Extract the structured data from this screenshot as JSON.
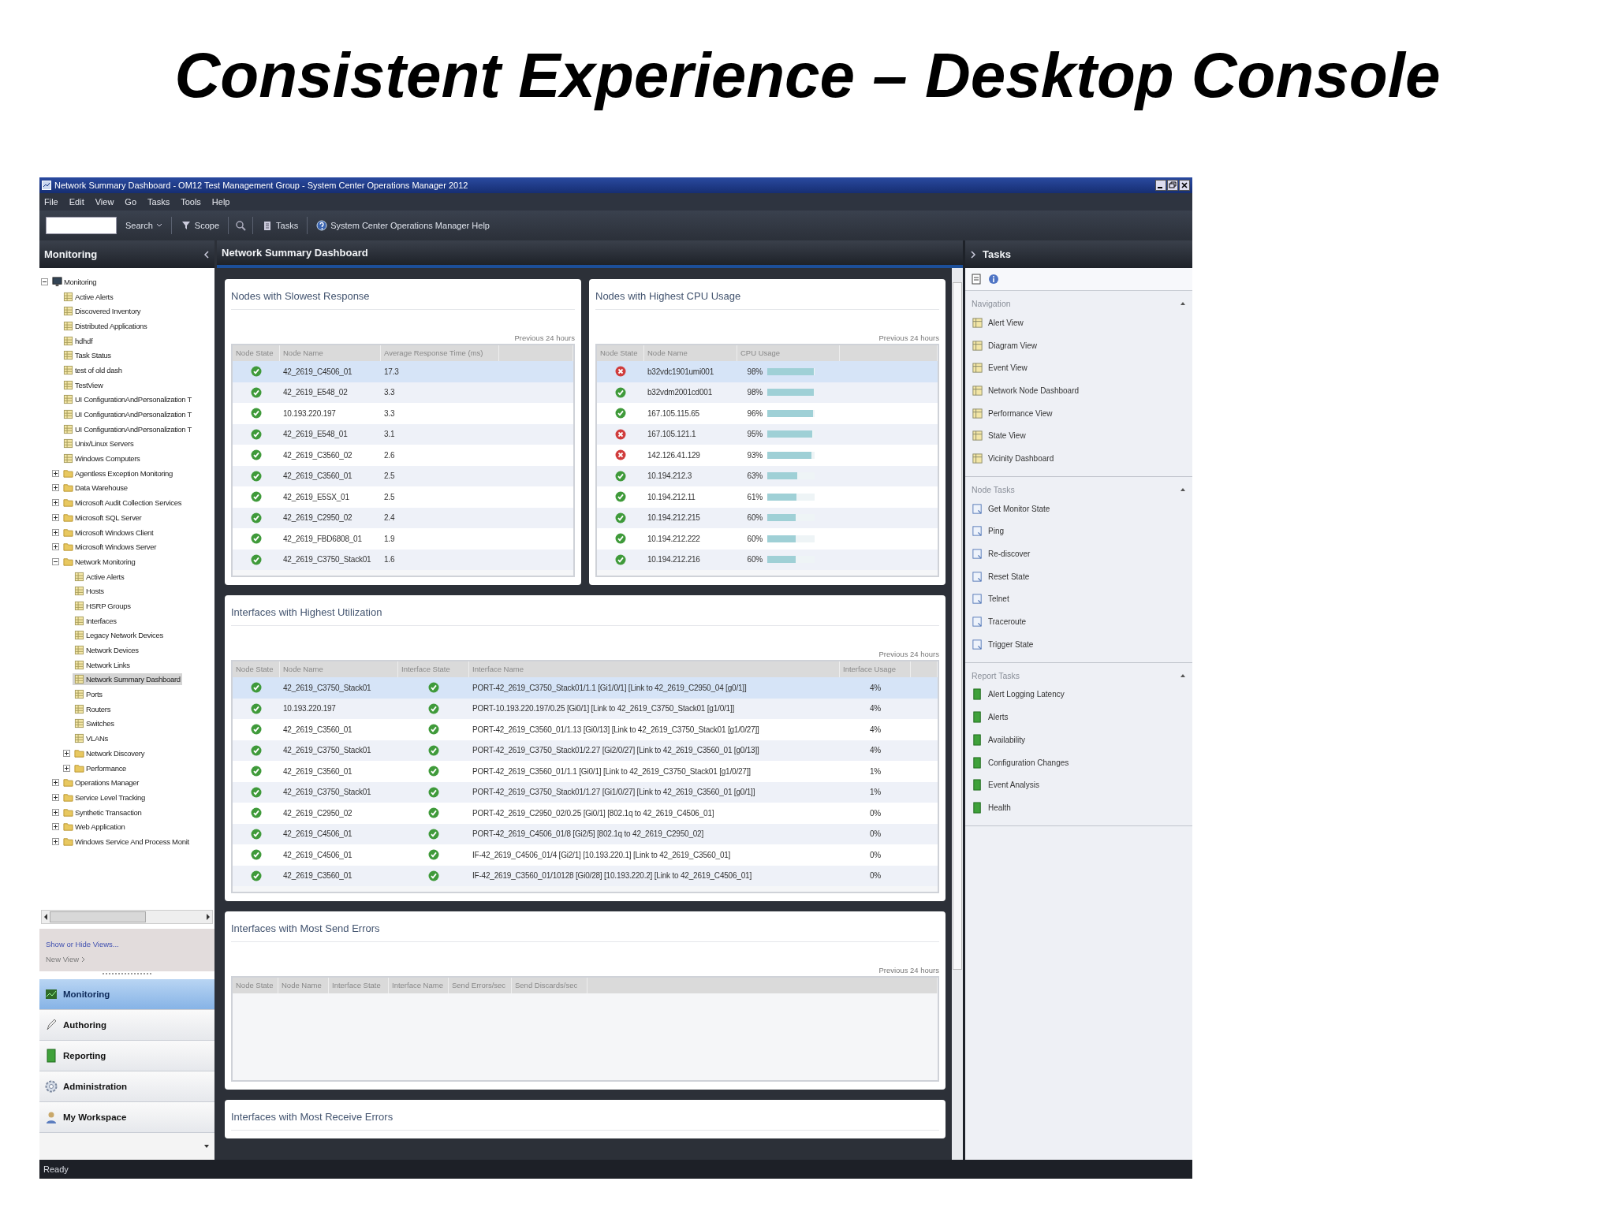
{
  "slide_title": "Consistent Experience – Desktop Console",
  "window": {
    "title": "Network Summary Dashboard - OM12 Test Management Group - System Center Operations Manager 2012"
  },
  "menu": [
    "File",
    "Edit",
    "View",
    "Go",
    "Tasks",
    "Tools",
    "Help"
  ],
  "toolbar": {
    "search_button": "Search",
    "scope_button": "Scope",
    "tasks_button": "Tasks",
    "help_button": "System Center Operations Manager Help"
  },
  "navigation_pane": {
    "header": "Monitoring",
    "tree": [
      {
        "label": "Monitoring",
        "kind": "root",
        "expanded": true,
        "selected": false,
        "children": [
          {
            "label": "Active Alerts",
            "kind": "view",
            "selected": false
          },
          {
            "label": "Discovered Inventory",
            "kind": "view",
            "selected": false
          },
          {
            "label": "Distributed Applications",
            "kind": "view",
            "selected": false
          },
          {
            "label": "hdhdf",
            "kind": "view",
            "selected": false
          },
          {
            "label": "Task Status",
            "kind": "view",
            "selected": false
          },
          {
            "label": "test of old dash",
            "kind": "view",
            "selected": false
          },
          {
            "label": "TestView",
            "kind": "view",
            "selected": false
          },
          {
            "label": "UI ConfigurationAndPersonalization T",
            "kind": "view",
            "selected": false
          },
          {
            "label": "UI ConfigurationAndPersonalization T",
            "kind": "view",
            "selected": false
          },
          {
            "label": "UI ConfigurationAndPersonalization T",
            "kind": "view",
            "selected": false
          },
          {
            "label": "Unix/Linux Servers",
            "kind": "view",
            "selected": false
          },
          {
            "label": "Windows Computers",
            "kind": "view",
            "selected": false
          },
          {
            "label": "Agentless Exception Monitoring",
            "kind": "folder",
            "expanded": false,
            "selected": false
          },
          {
            "label": "Data Warehouse",
            "kind": "folder",
            "expanded": false,
            "selected": false
          },
          {
            "label": "Microsoft Audit Collection Services",
            "kind": "folder",
            "expanded": false,
            "selected": false
          },
          {
            "label": "Microsoft SQL Server",
            "kind": "folder",
            "expanded": false,
            "selected": false
          },
          {
            "label": "Microsoft Windows Client",
            "kind": "folder",
            "expanded": false,
            "selected": false
          },
          {
            "label": "Microsoft Windows Server",
            "kind": "folder",
            "expanded": false,
            "selected": false
          },
          {
            "label": "Network Monitoring",
            "kind": "folder",
            "expanded": true,
            "selected": false,
            "children": [
              {
                "label": "Active Alerts",
                "kind": "view",
                "selected": false
              },
              {
                "label": "Hosts",
                "kind": "view",
                "selected": false
              },
              {
                "label": "HSRP Groups",
                "kind": "view",
                "selected": false
              },
              {
                "label": "Interfaces",
                "kind": "view",
                "selected": false
              },
              {
                "label": "Legacy Network Devices",
                "kind": "view",
                "selected": false
              },
              {
                "label": "Network Devices",
                "kind": "view",
                "selected": false
              },
              {
                "label": "Network Links",
                "kind": "view",
                "selected": false
              },
              {
                "label": "Network Summary Dashboard",
                "kind": "view",
                "selected": true
              },
              {
                "label": "Ports",
                "kind": "view",
                "selected": false
              },
              {
                "label": "Routers",
                "kind": "view",
                "selected": false
              },
              {
                "label": "Switches",
                "kind": "view",
                "selected": false
              },
              {
                "label": "VLANs",
                "kind": "view",
                "selected": false
              },
              {
                "label": "Network Discovery",
                "kind": "folder",
                "expanded": false,
                "selected": false
              },
              {
                "label": "Performance",
                "kind": "folder",
                "expanded": false,
                "selected": false
              }
            ]
          },
          {
            "label": "Operations Manager",
            "kind": "folder",
            "expanded": false,
            "selected": false
          },
          {
            "label": "Service Level Tracking",
            "kind": "folder",
            "expanded": false,
            "selected": false
          },
          {
            "label": "Synthetic Transaction",
            "kind": "folder",
            "expanded": false,
            "selected": false
          },
          {
            "label": "Web Application",
            "kind": "folder",
            "expanded": false,
            "selected": false
          },
          {
            "label": "Windows Service And Process Monit",
            "kind": "folder",
            "expanded": false,
            "selected": false
          }
        ]
      }
    ],
    "show_hide_link": "Show or Hide Views...",
    "new_view": {
      "label": "New View",
      "disabled": true
    },
    "workspaces": [
      {
        "label": "Monitoring",
        "selected": true
      },
      {
        "label": "Authoring",
        "selected": false
      },
      {
        "label": "Reporting",
        "selected": false
      },
      {
        "label": "Administration",
        "selected": false
      },
      {
        "label": "My Workspace",
        "selected": false
      }
    ]
  },
  "dashboard": {
    "header": "Network Summary Dashboard",
    "widgets": [
      {
        "kind": "response",
        "title": "Nodes with Slowest Response",
        "period": "Previous 24 hours",
        "columns": [
          "Node State",
          "Node Name",
          "Average Response Time (ms)"
        ],
        "rows": [
          {
            "selected": true,
            "node_healthy": true,
            "node_name": "42_2619_C4506_01",
            "response_time": "17.3"
          },
          {
            "selected": false,
            "node_healthy": true,
            "node_name": "42_2619_E548_02",
            "response_time": "3.3"
          },
          {
            "selected": false,
            "node_healthy": true,
            "node_name": "10.193.220.197",
            "response_time": "3.3"
          },
          {
            "selected": false,
            "node_healthy": true,
            "node_name": "42_2619_E548_01",
            "response_time": "3.1"
          },
          {
            "selected": false,
            "node_healthy": true,
            "node_name": "42_2619_C3560_02",
            "response_time": "2.6"
          },
          {
            "selected": false,
            "node_healthy": true,
            "node_name": "42_2619_C3560_01",
            "response_time": "2.5"
          },
          {
            "selected": false,
            "node_healthy": true,
            "node_name": "42_2619_E5SX_01",
            "response_time": "2.5"
          },
          {
            "selected": false,
            "node_healthy": true,
            "node_name": "42_2619_C2950_02",
            "response_time": "2.4"
          },
          {
            "selected": false,
            "node_healthy": true,
            "node_name": "42_2619_FBD6808_01",
            "response_time": "1.9"
          },
          {
            "selected": false,
            "node_healthy": true,
            "node_name": "42_2619_C3750_Stack01",
            "response_time": "1.6"
          }
        ]
      },
      {
        "kind": "cpu",
        "title": "Nodes with Highest CPU Usage",
        "period": "Previous 24 hours",
        "columns": [
          "Node State",
          "Node Name",
          "CPU Usage"
        ],
        "rows": [
          {
            "selected": true,
            "node_healthy": false,
            "node_name": "b32vdc1901umi001",
            "cpu_usage": "98%",
            "level": 0.98
          },
          {
            "selected": false,
            "node_healthy": true,
            "node_name": "b32vdm2001cd001",
            "cpu_usage": "98%",
            "level": 0.98
          },
          {
            "selected": false,
            "node_healthy": true,
            "node_name": "167.105.115.65",
            "cpu_usage": "96%",
            "level": 0.96
          },
          {
            "selected": false,
            "node_healthy": false,
            "node_name": "167.105.121.1",
            "cpu_usage": "95%",
            "level": 0.95
          },
          {
            "selected": false,
            "node_healthy": false,
            "node_name": "142.126.41.129",
            "cpu_usage": "93%",
            "level": 0.93
          },
          {
            "selected": false,
            "node_healthy": true,
            "node_name": "10.194.212.3",
            "cpu_usage": "63%",
            "level": 0.63
          },
          {
            "selected": false,
            "node_healthy": true,
            "node_name": "10.194.212.11",
            "cpu_usage": "61%",
            "level": 0.61
          },
          {
            "selected": false,
            "node_healthy": true,
            "node_name": "10.194.212.215",
            "cpu_usage": "60%",
            "level": 0.6
          },
          {
            "selected": false,
            "node_healthy": true,
            "node_name": "10.194.212.222",
            "cpu_usage": "60%",
            "level": 0.6
          },
          {
            "selected": false,
            "node_healthy": true,
            "node_name": "10.194.212.216",
            "cpu_usage": "60%",
            "level": 0.6
          }
        ]
      },
      {
        "kind": "interfaces",
        "title": "Interfaces with Highest Utilization",
        "period": "Previous 24 hours",
        "columns": [
          "Node State",
          "Node Name",
          "Interface State",
          "Interface Name",
          "Interface Usage"
        ],
        "rows": [
          {
            "selected": true,
            "node_healthy": true,
            "node_name": "42_2619_C3750_Stack01",
            "interface_healthy": true,
            "interface_name": "PORT-42_2619_C3750_Stack01/1.1 [Gi1/0/1] [Link to 42_2619_C2950_04 [g0/1]]",
            "interface_usage": "4%"
          },
          {
            "selected": false,
            "node_healthy": true,
            "node_name": "10.193.220.197",
            "interface_healthy": true,
            "interface_name": "PORT-10.193.220.197/0.25 [Gi0/1] [Link to 42_2619_C3750_Stack01 [g1/0/1]]",
            "interface_usage": "4%"
          },
          {
            "selected": false,
            "node_healthy": true,
            "node_name": "42_2619_C3560_01",
            "interface_healthy": true,
            "interface_name": "PORT-42_2619_C3560_01/1.13 [Gi0/13] [Link to 42_2619_C3750_Stack01 [g1/0/27]]",
            "interface_usage": "4%"
          },
          {
            "selected": false,
            "node_healthy": true,
            "node_name": "42_2619_C3750_Stack01",
            "interface_healthy": true,
            "interface_name": "PORT-42_2619_C3750_Stack01/2.27 [Gi2/0/27] [Link to 42_2619_C3560_01 [g0/13]]",
            "interface_usage": "4%"
          },
          {
            "selected": false,
            "node_healthy": true,
            "node_name": "42_2619_C3560_01",
            "interface_healthy": true,
            "interface_name": "PORT-42_2619_C3560_01/1.1 [Gi0/1] [Link to 42_2619_C3750_Stack01 [g1/0/27]]",
            "interface_usage": "1%"
          },
          {
            "selected": false,
            "node_healthy": true,
            "node_name": "42_2619_C3750_Stack01",
            "interface_healthy": true,
            "interface_name": "PORT-42_2619_C3750_Stack01/1.27 [Gi1/0/27] [Link to 42_2619_C3560_01 [g0/1]]",
            "interface_usage": "1%"
          },
          {
            "selected": false,
            "node_healthy": true,
            "node_name": "42_2619_C2950_02",
            "interface_healthy": true,
            "interface_name": "PORT-42_2619_C2950_02/0.25 [Gi0/1] [802.1q to 42_2619_C4506_01]",
            "interface_usage": "0%"
          },
          {
            "selected": false,
            "node_healthy": true,
            "node_name": "42_2619_C4506_01",
            "interface_healthy": true,
            "interface_name": "PORT-42_2619_C4506_01/8 [Gi2/5] [802.1q to 42_2619_C2950_02]",
            "interface_usage": "0%"
          },
          {
            "selected": false,
            "node_healthy": true,
            "node_name": "42_2619_C4506_01",
            "interface_healthy": true,
            "interface_name": "IF-42_2619_C4506_01/4 [Gi2/1] [10.193.220.1] [Link to 42_2619_C3560_01]",
            "interface_usage": "0%"
          },
          {
            "selected": false,
            "node_healthy": true,
            "node_name": "42_2619_C3560_01",
            "interface_healthy": true,
            "interface_name": "IF-42_2619_C3560_01/10128 [Gi0/28] [10.193.220.2] [Link to 42_2619_C4506_01]",
            "interface_usage": "0%"
          }
        ]
      },
      {
        "kind": "errors",
        "title": "Interfaces with Most Send Errors",
        "period": "Previous 24 hours",
        "columns": [
          "Node State",
          "Node Name",
          "Interface State",
          "Interface Name",
          "Send Errors/sec",
          "Send Discards/sec"
        ]
      },
      {
        "kind": "errors",
        "title": "Interfaces with Most Receive Errors"
      }
    ]
  },
  "tasks_pane": {
    "header": "Tasks",
    "sections": [
      {
        "title": "Navigation",
        "expanded": true,
        "items": [
          "Alert View",
          "Diagram View",
          "Event View",
          "Network Node Dashboard",
          "Performance View",
          "State View",
          "Vicinity Dashboard"
        ]
      },
      {
        "title": "Node Tasks",
        "expanded": true,
        "items": [
          "Get Monitor State",
          "Ping",
          "Re-discover",
          "Reset State",
          "Telnet",
          "Traceroute",
          "Trigger State"
        ]
      },
      {
        "title": "Report Tasks",
        "expanded": true,
        "items": [
          "Alert Logging Latency",
          "Alerts",
          "Availability",
          "Configuration Changes",
          "Event Analysis",
          "Health"
        ]
      }
    ]
  },
  "status_bar": "Ready"
}
